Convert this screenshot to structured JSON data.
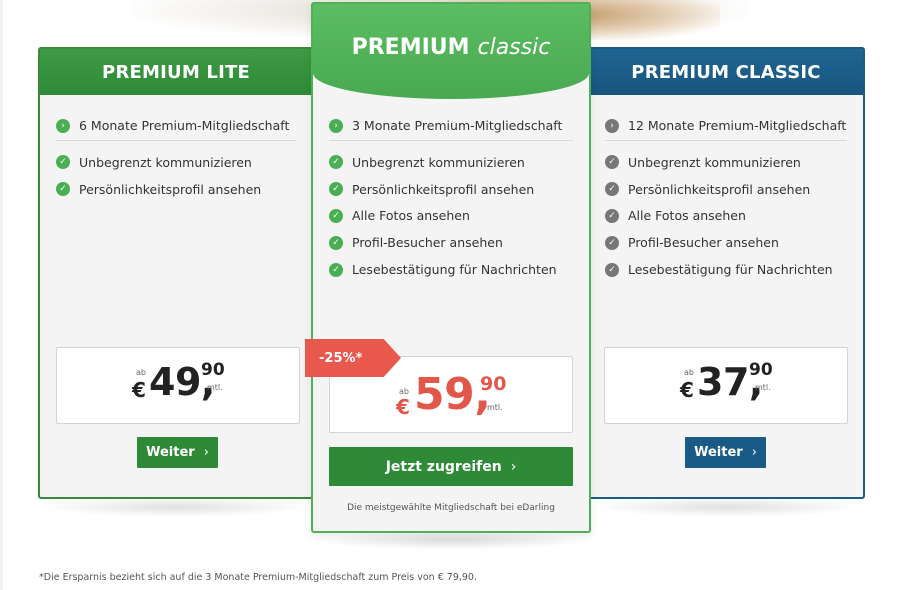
{
  "plans": [
    {
      "title": "PREMIUM LITE",
      "features": [
        "6 Monate Premium-Mitgliedschaft",
        "Unbegrenzt kommunizieren",
        "Persönlichkeitsprofil ansehen"
      ],
      "price": {
        "ab": "ab",
        "currency": "€",
        "whole": "49,",
        "cents": "90",
        "unit": "mtl."
      },
      "button_label": "Weiter",
      "accent": "#2f8a37"
    },
    {
      "title_main": "PREMIUM",
      "title_script": "classic",
      "features": [
        "3 Monate Premium-Mitgliedschaft",
        "Unbegrenzt kommunizieren",
        "Persönlichkeitsprofil ansehen",
        "Alle Fotos ansehen",
        "Profil-Besucher ansehen",
        "Lesebestätigung für Nachrichten"
      ],
      "badge": "-25%*",
      "price": {
        "ab": "ab",
        "currency": "€",
        "whole": "59,",
        "cents": "90",
        "unit": "mtl."
      },
      "button_label": "Jetzt zugreifen",
      "note": "Die meistgewählte Mitgliedschaft bei eDarling",
      "accent": "#4fb058"
    },
    {
      "title": "PREMIUM CLASSIC",
      "features": [
        "12 Monate Premium-Mitgliedschaft",
        "Unbegrenzt kommunizieren",
        "Persönlichkeitsprofil ansehen",
        "Alle Fotos ansehen",
        "Profil-Besucher ansehen",
        "Lesebestätigung für Nachrichten"
      ],
      "price": {
        "ab": "ab",
        "currency": "€",
        "whole": "37,",
        "cents": "90",
        "unit": "mtl."
      },
      "button_label": "Weiter",
      "accent": "#1a5a86"
    }
  ],
  "icons": {
    "check": "check-circle-icon",
    "chevron": "chevron-right-icon"
  },
  "colors": {
    "price_highlight": "#e2574a",
    "badge": "#e9584c"
  },
  "footnote": "*Die Ersparnis bezieht sich auf die 3 Monate Premium-Mitgliedschaft zum Preis von € 79,90."
}
